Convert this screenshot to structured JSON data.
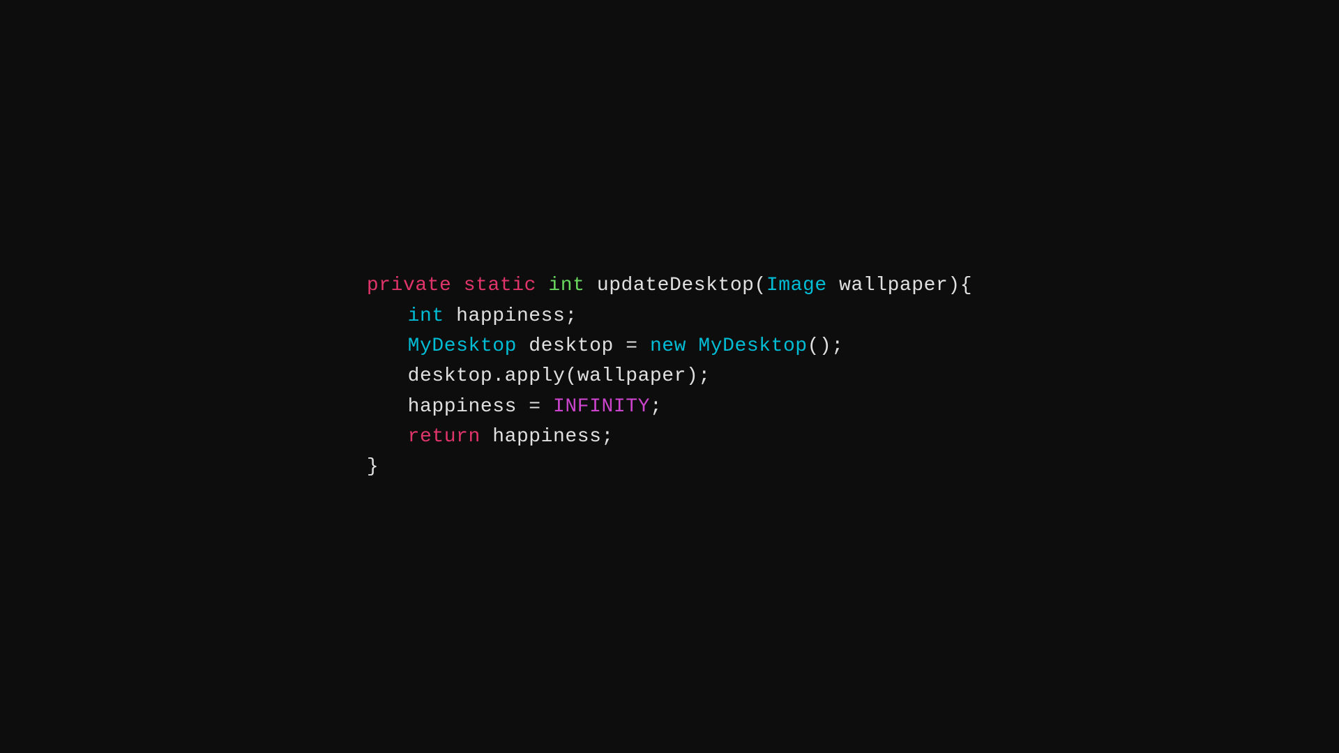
{
  "code": {
    "line1": {
      "private": "private",
      "space1": " ",
      "static": "static",
      "space2": " ",
      "int": "int",
      "space3": " ",
      "rest": "updateDesktop(",
      "image": "Image",
      "wallpaper": " wallpaper){"
    },
    "line2": {
      "int": "int",
      "rest": " happiness;"
    },
    "line3": {
      "mydesktop": "MyDesktop",
      "rest1": " desktop = ",
      "new": "new",
      "space": " ",
      "mydesktop2": "MyDesktop",
      "rest2": "();"
    },
    "line4": {
      "text": "desktop.apply(wallpaper);"
    },
    "line5": {
      "text1": "happiness = ",
      "infinity": "INFINITY",
      "text2": ";"
    },
    "line6": {
      "return": "return",
      "rest": " happiness;"
    },
    "line7": {
      "brace": "}"
    }
  }
}
